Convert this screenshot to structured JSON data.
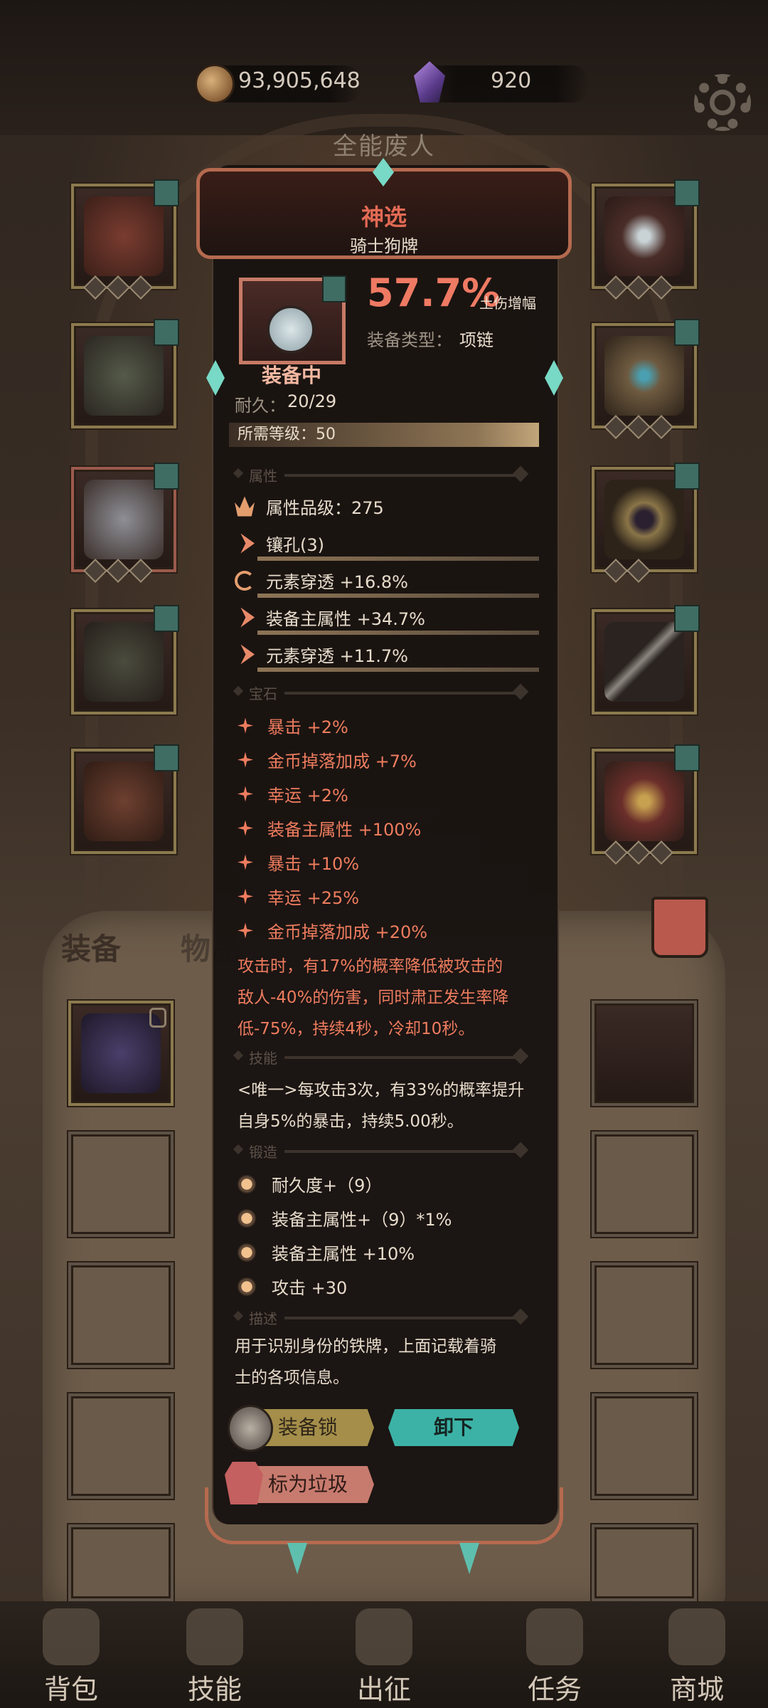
{
  "currency": {
    "gold": "93,905,648",
    "gems": "920"
  },
  "character": {
    "name": "全能废人"
  },
  "tabs": {
    "equipment": "装备",
    "items": "物品"
  },
  "item": {
    "quality": "神选",
    "name": "骑士狗牌",
    "damage_percent": "57.7%",
    "damage_label": "土伤增幅",
    "type_label": "装备类型：",
    "type_value": "项链",
    "equipped": "装备中",
    "durability_label": "耐久：",
    "durability_value": "20/29",
    "required_level": "所需等级：50"
  },
  "sections": {
    "attributes": "属性",
    "gems": "宝石",
    "skills": "技能",
    "forging": "锻造",
    "description": "描述"
  },
  "attributes": [
    {
      "icon": "crown-icon",
      "text": "属性品级：275"
    },
    {
      "icon": "socket-icon",
      "text": "镶孔(3)"
    },
    {
      "icon": "cycle-icon",
      "text": "元素穿透 +16.8%"
    },
    {
      "icon": "socket-icon",
      "text": "装备主属性 +34.7%"
    },
    {
      "icon": "socket-icon",
      "text": "元素穿透 +11.7%"
    }
  ],
  "gem_stats": [
    "暴击 +2%",
    "金币掉落加成 +7%",
    "幸运 +2%",
    "装备主属性 +100%",
    "暴击 +10%",
    "幸运 +25%",
    "金币掉落加成 +20%"
  ],
  "effect": [
    "攻击时，有17%的概率降低被攻击的",
    "敌人-40%的伤害，同时肃正发生率降",
    "低-75%，持续4秒，冷却10秒。"
  ],
  "skill": [
    "<唯一>每攻击3次，有33%的概率提升",
    "自身5%的暴击，持续5.00秒。"
  ],
  "forging": [
    "耐久度+（9）",
    "装备主属性+（9）*1%",
    "装备主属性 +10%",
    "攻击 +30"
  ],
  "description": [
    "用于识别身份的铁牌，上面记载着骑",
    "士的各项信息。"
  ],
  "buttons": {
    "lock": "装备锁",
    "unequip": "卸下",
    "junk": "标为垃圾"
  },
  "nav": [
    "背包",
    "技能",
    "出征",
    "任务",
    "商城"
  ]
}
